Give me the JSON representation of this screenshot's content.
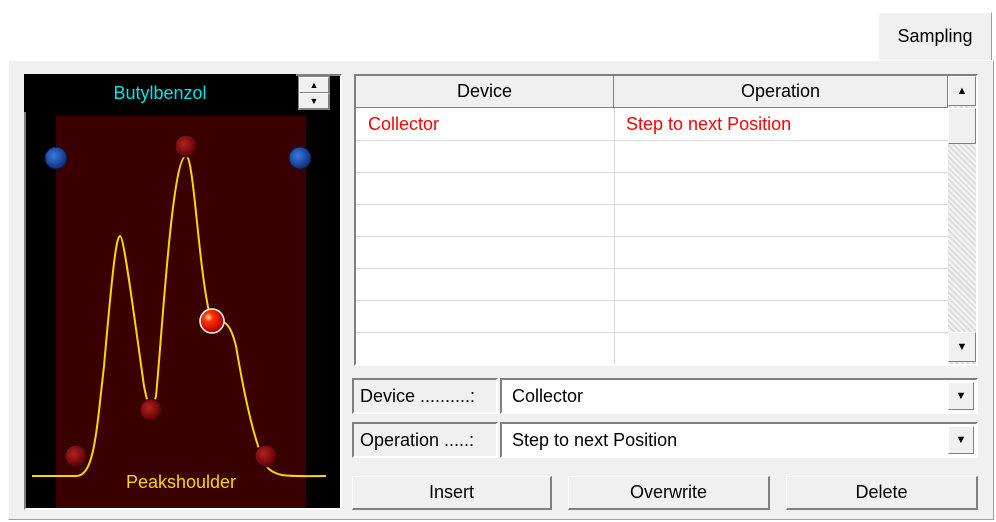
{
  "tabs": {
    "active_label": "Sampling"
  },
  "chromatogram": {
    "compound": "Butylbenzol",
    "event_label": "Peakshoulder",
    "colors": {
      "band": "#3a0000",
      "trace": "#ffd400",
      "marker": "#8b0000",
      "active_marker": "#ff2a00",
      "baseline_marker": "#1a3aa0"
    }
  },
  "table": {
    "headers": [
      "Device",
      "Operation"
    ],
    "rows": [
      {
        "device": "Collector",
        "operation": "Step to next Position"
      }
    ],
    "row_color": "#ff0000"
  },
  "form": {
    "device_label": "Device ..........:",
    "device_value": "Collector",
    "operation_label": "Operation .....:",
    "operation_value": "Step to next Position"
  },
  "buttons": {
    "insert": "Insert",
    "overwrite": "Overwrite",
    "delete": "Delete"
  }
}
